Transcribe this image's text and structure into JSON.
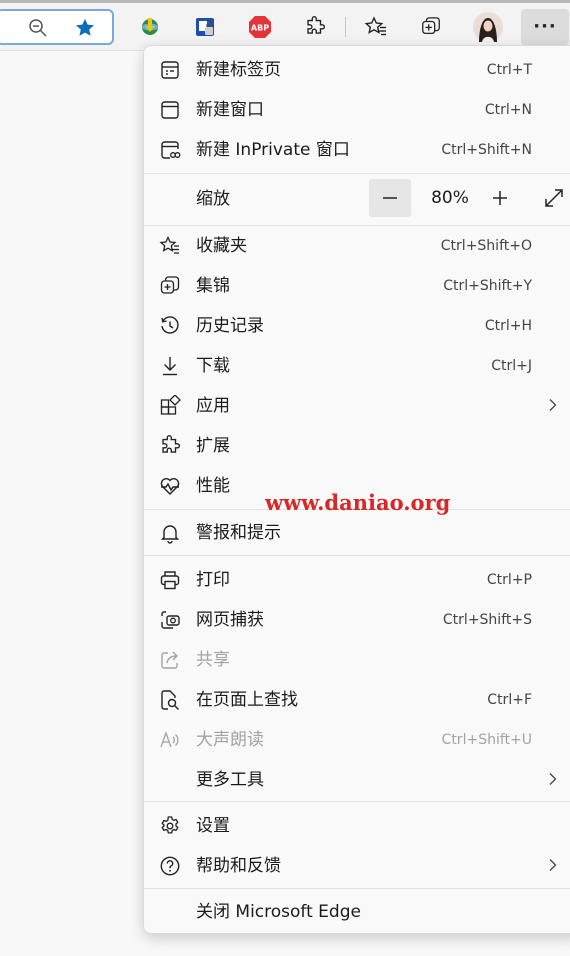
{
  "toolbar": {
    "icons": [
      "zoom-out-icon",
      "favorite-star-icon",
      "idm-extension-icon",
      "lock-extension-icon",
      "adblock-plus-icon",
      "extensions-puzzle-icon",
      "favorites-icon",
      "collections-icon",
      "profile-avatar",
      "more-options-icon"
    ],
    "abp_text": "ABP",
    "more_text": "···"
  },
  "menu": {
    "new_tab": {
      "label": "新建标签页",
      "shortcut": "Ctrl+T"
    },
    "new_window": {
      "label": "新建窗口",
      "shortcut": "Ctrl+N"
    },
    "new_inprivate": {
      "label": "新建 InPrivate 窗口",
      "shortcut": "Ctrl+Shift+N"
    },
    "zoom": {
      "label": "缩放",
      "value": "80%"
    },
    "favorites": {
      "label": "收藏夹",
      "shortcut": "Ctrl+Shift+O"
    },
    "collections": {
      "label": "集锦",
      "shortcut": "Ctrl+Shift+Y"
    },
    "history": {
      "label": "历史记录",
      "shortcut": "Ctrl+H"
    },
    "downloads": {
      "label": "下载",
      "shortcut": "Ctrl+J"
    },
    "apps": {
      "label": "应用"
    },
    "extensions": {
      "label": "扩展"
    },
    "performance": {
      "label": "性能"
    },
    "alerts": {
      "label": "警报和提示"
    },
    "print": {
      "label": "打印",
      "shortcut": "Ctrl+P"
    },
    "web_capture": {
      "label": "网页捕获",
      "shortcut": "Ctrl+Shift+S"
    },
    "share": {
      "label": "共享",
      "disabled": true
    },
    "find": {
      "label": "在页面上查找",
      "shortcut": "Ctrl+F"
    },
    "read_aloud": {
      "label": "大声朗读",
      "shortcut": "Ctrl+Shift+U",
      "disabled": true
    },
    "more_tools": {
      "label": "更多工具"
    },
    "settings": {
      "label": "设置"
    },
    "help": {
      "label": "帮助和反馈"
    },
    "close": {
      "label": "关闭 Microsoft Edge"
    }
  },
  "watermark": "www.daniao.org",
  "colors": {
    "accent": "#0f6cbd",
    "abp_red": "#e4343a",
    "watermark": "#d92626",
    "disabled_text": "#a3a3a3"
  }
}
